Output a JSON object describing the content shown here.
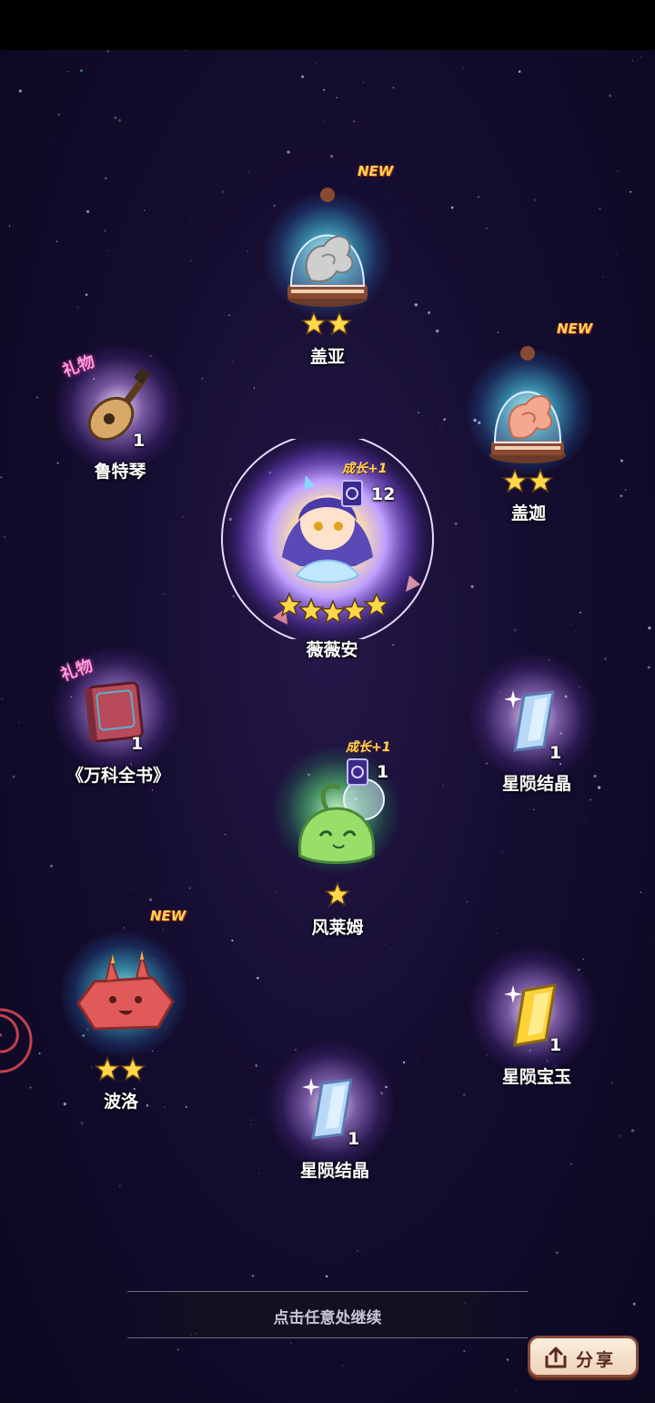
{
  "screen": {
    "continue_hint": "点击任意处继续",
    "share_label": "分享"
  },
  "rewards": [
    {
      "id": "gaia",
      "name": "盖亚",
      "stars": 2,
      "new_tag": "NEW",
      "icon": "ghost-bell-jar-icon"
    },
    {
      "id": "gaga",
      "name": "盖迦",
      "stars": 2,
      "new_tag": "NEW",
      "icon": "pink-ghost-bell-jar-icon"
    },
    {
      "id": "lute",
      "name": "鲁特琴",
      "count": "1",
      "gift_tag": "礼物",
      "icon": "lute-icon"
    },
    {
      "id": "vivian",
      "name": "薇薇安",
      "stars": 5,
      "growth_tag": "成长+1",
      "card_count": "12",
      "icon": "vivian-character-icon"
    },
    {
      "id": "encyclopedia",
      "name": "《万科全书》",
      "count": "1",
      "gift_tag": "礼物",
      "icon": "book-icon"
    },
    {
      "id": "crystal1",
      "name": "星陨结晶",
      "count": "1",
      "icon": "crystal-icon"
    },
    {
      "id": "slime",
      "name": "风莱姆",
      "stars": 1,
      "growth_tag": "成长+1",
      "card_count": "1",
      "icon": "green-slime-icon"
    },
    {
      "id": "polo",
      "name": "波洛",
      "stars": 2,
      "new_tag": "NEW",
      "icon": "red-rock-creature-icon"
    },
    {
      "id": "gem",
      "name": "星陨宝玉",
      "count": "1",
      "icon": "gold-gem-icon"
    },
    {
      "id": "crystal2",
      "name": "星陨结晶",
      "count": "1",
      "icon": "crystal-icon"
    }
  ],
  "colors": {
    "background": "#150d30",
    "star_fill": "#ffd84a",
    "new_tag": "#ffd25a",
    "gift_tag": "#ff9ee0",
    "share_button": "#f4e0c8"
  }
}
